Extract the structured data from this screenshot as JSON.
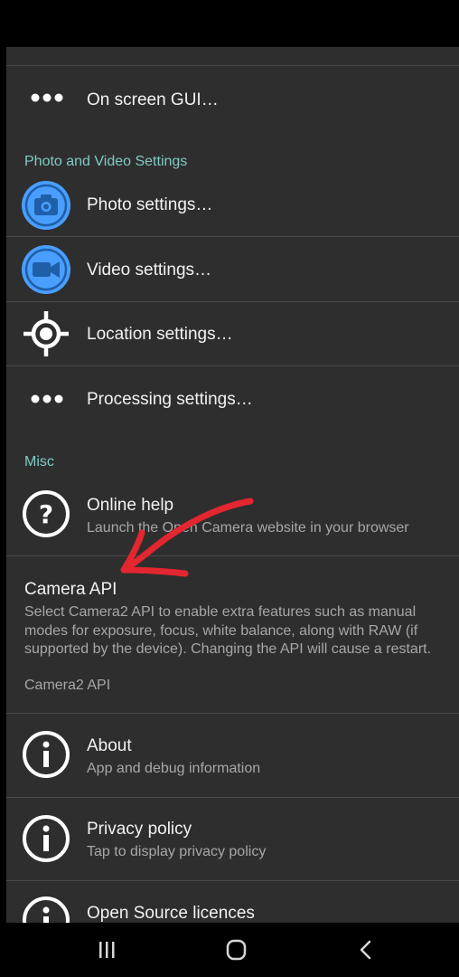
{
  "items": {
    "onscreen_gui": {
      "title": "On screen GUI…"
    },
    "photo": {
      "title": "Photo settings…"
    },
    "video": {
      "title": "Video settings…"
    },
    "location": {
      "title": "Location settings…"
    },
    "processing": {
      "title": "Processing settings…"
    },
    "online_help": {
      "title": "Online help",
      "subtitle": "Launch the Open Camera website in your browser"
    },
    "about": {
      "title": "About",
      "subtitle": "App and debug information"
    },
    "privacy": {
      "title": "Privacy policy",
      "subtitle": "Tap to display privacy policy"
    },
    "licences": {
      "title": "Open Source licences"
    }
  },
  "sections": {
    "photo_video": "Photo and Video Settings",
    "misc": "Misc"
  },
  "camera_api": {
    "title": "Camera API",
    "description": "Select Camera2 API to enable extra features such as manual modes for exposure, focus, white balance, along with RAW (if supported by the device). Changing the API will cause a restart.",
    "value": "Camera2 API"
  },
  "colors": {
    "background": "#2e2e2e",
    "accent_blue": "#4a9eff",
    "section_header": "#80cbc4",
    "annotation_red": "#e3262f"
  },
  "icons": [
    "more-dots-icon",
    "camera-icon",
    "video-icon",
    "location-target-icon",
    "help-icon",
    "info-icon",
    "nav-recents-icon",
    "nav-home-icon",
    "nav-back-icon"
  ]
}
